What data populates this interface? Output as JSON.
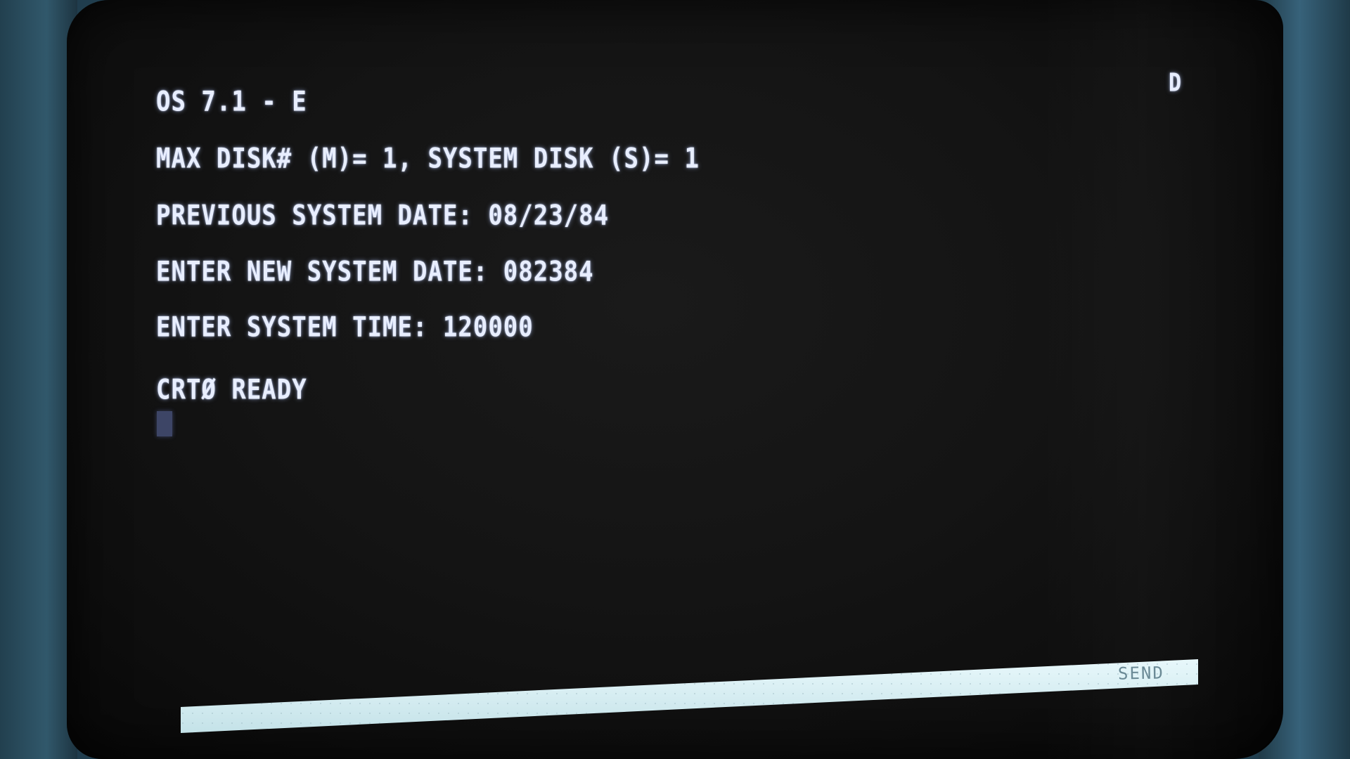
{
  "terminal": {
    "lines": [
      "OS 7.1 - E",
      "MAX DISK# (M)= 1, SYSTEM DISK (S)= 1",
      "PREVIOUS SYSTEM DATE: 08/23/84",
      "ENTER NEW SYSTEM DATE: 082384",
      "ENTER SYSTEM TIME: 120000",
      "CRTØ READY"
    ],
    "indicator": "D",
    "cursor": "block-cursor"
  },
  "status_bar": {
    "send_label": "SEND"
  },
  "colors": {
    "screen_text": "#e8eeff",
    "screen_background": "#141414",
    "status_bar": "#d6f0f4",
    "bezel": "#2d5064"
  }
}
